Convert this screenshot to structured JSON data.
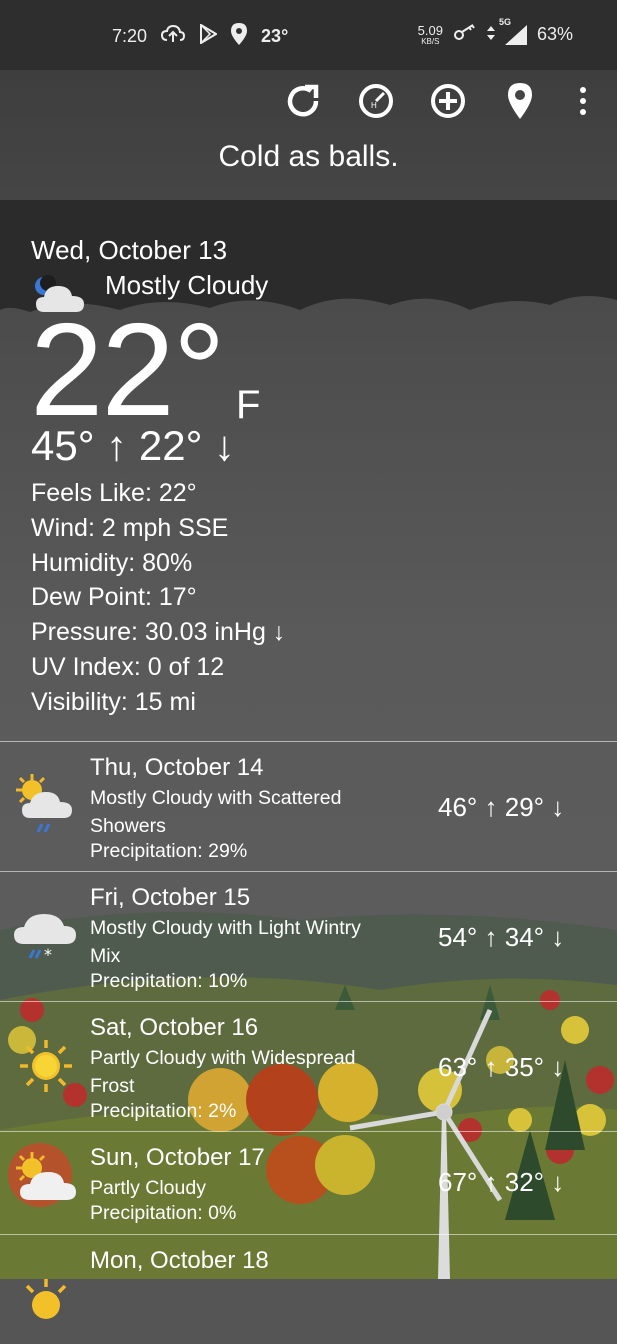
{
  "status_bar": {
    "time": "7:20",
    "temp": "23°",
    "net_speed_value": "5.09",
    "net_speed_unit": "KB/S",
    "network": "5G",
    "battery": "63%",
    "icons": [
      "cloud-upload-icon",
      "play-store-icon",
      "location-pin-icon",
      "vpn-key-icon",
      "data-arrows-icon",
      "signal-icon"
    ]
  },
  "toolbar": {
    "buttons": [
      "refresh-icon",
      "history-icon",
      "add-icon",
      "location-icon",
      "more-vert-icon"
    ]
  },
  "quote": "Cold as balls.",
  "current": {
    "date": "Wed, October 13",
    "condition": "Mostly Cloudy",
    "icon": "moon-cloud-icon",
    "temp": "22°",
    "unit": "F",
    "hilo": "45° ↑  22° ↓",
    "feels_like": "Feels Like:  22°",
    "wind": "Wind:  2 mph SSE",
    "humidity": "Humidity:  80%",
    "dew_point": "Dew Point:  17°",
    "pressure": "Pressure:  30.03 inHg ↓",
    "uv_index": "UV Index:  0 of 12",
    "visibility": "Visibility:  15 mi"
  },
  "forecast": [
    {
      "date": "Thu, October 14",
      "condition": "Mostly Cloudy with Scattered Showers",
      "precip": "Precipitation:  29%",
      "hilo": "46° ↑  29° ↓",
      "icon": "sun-cloud-rain-icon"
    },
    {
      "date": "Fri, October 15",
      "condition": "Mostly Cloudy with Light Wintry Mix",
      "precip": "Precipitation:  10%",
      "hilo": "54° ↑  34° ↓",
      "icon": "cloud-sleet-icon"
    },
    {
      "date": "Sat, October 16",
      "condition": "Partly Cloudy with Widespread Frost",
      "precip": "Precipitation:  2%",
      "hilo": "63° ↑  35° ↓",
      "icon": "sun-icon"
    },
    {
      "date": "Sun, October 17",
      "condition": "Partly Cloudy",
      "precip": "Precipitation:  0%",
      "hilo": "67° ↑  32° ↓",
      "icon": "sun-cloud-icon"
    },
    {
      "date": "Mon, October 18",
      "condition": "",
      "precip": "",
      "hilo": "",
      "icon": "sun-icon"
    }
  ],
  "colors": {
    "sky": "#575757",
    "cloud_dark": "#2a2a2a",
    "hill": "#4a5a3a",
    "text": "#ffffff"
  }
}
